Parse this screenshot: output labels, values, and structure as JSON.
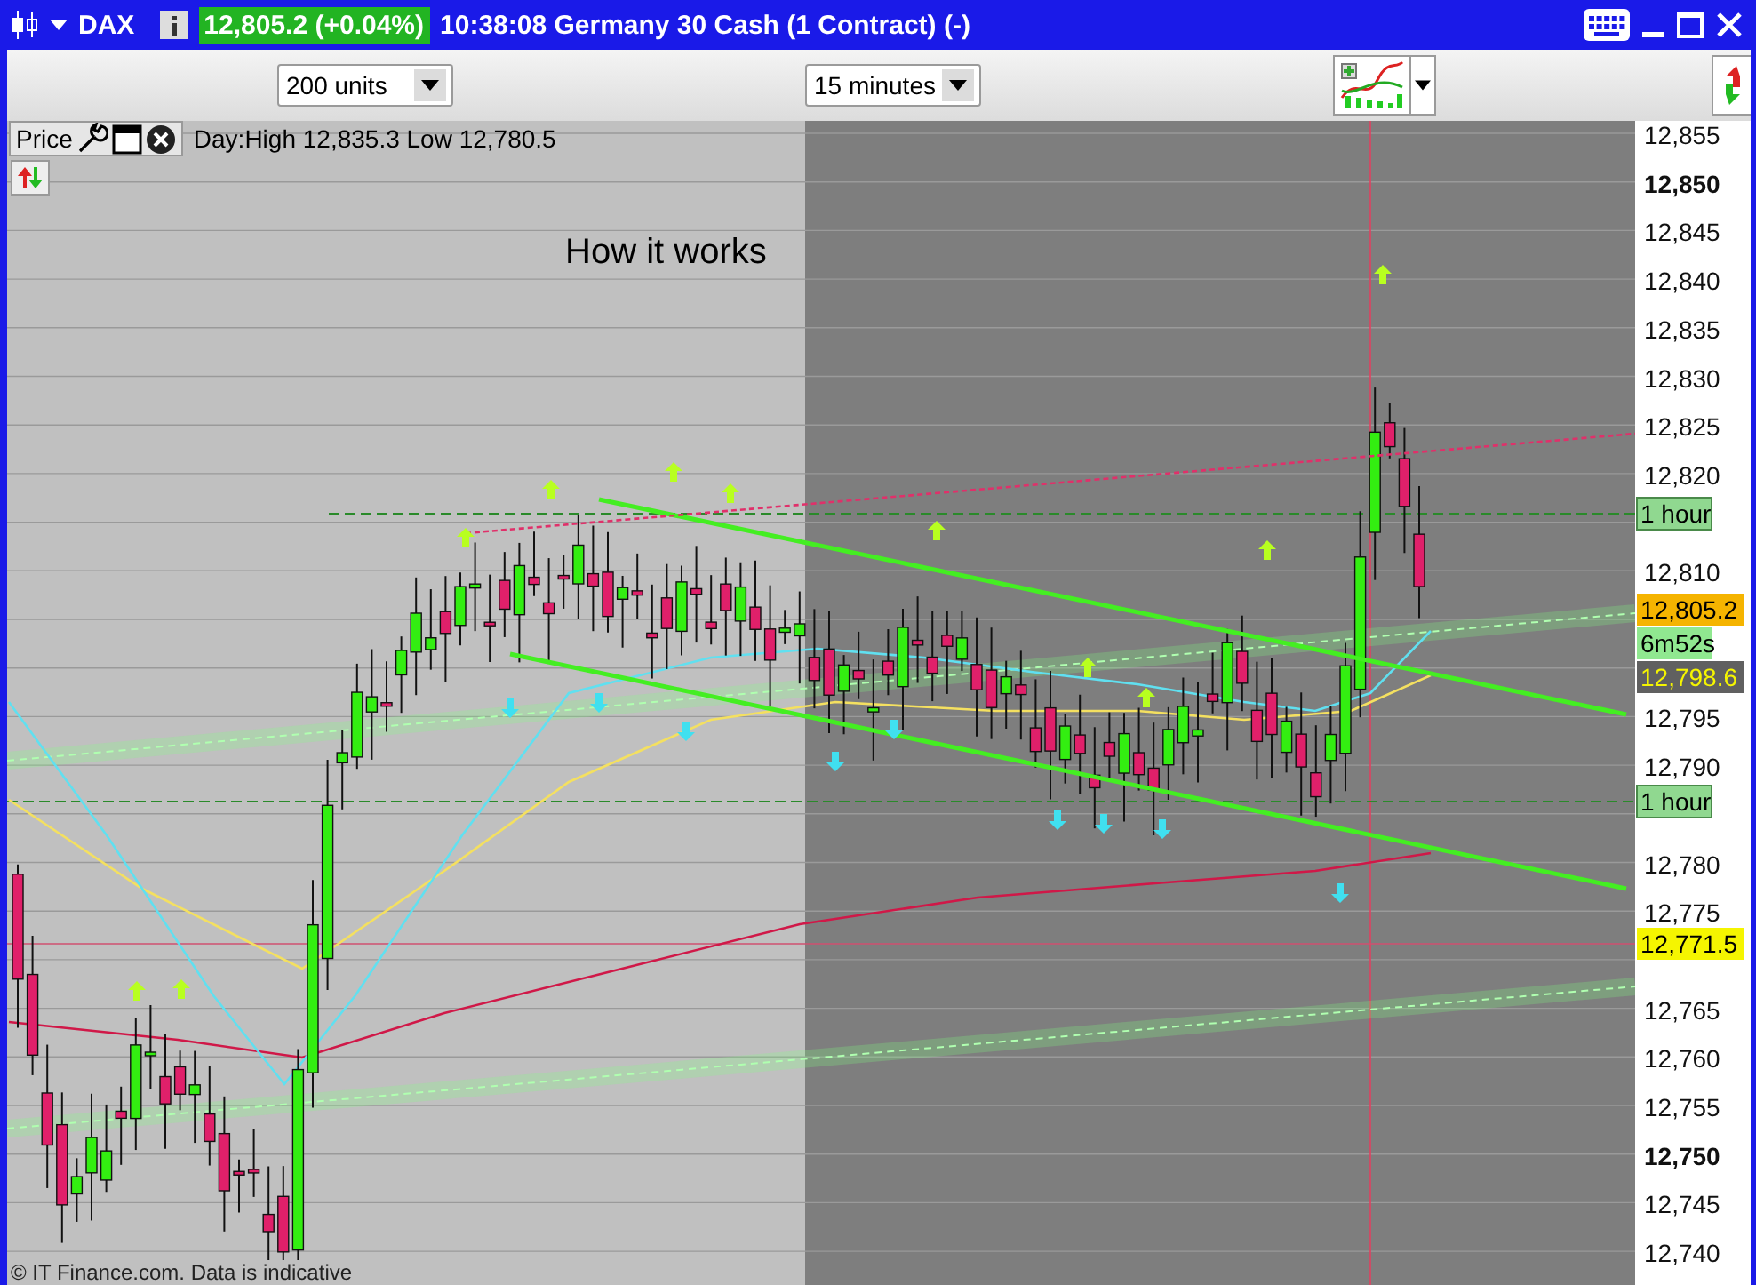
{
  "title_bar": {
    "instrument": "DAX",
    "price": "12,805.2 (+0.04%)",
    "description": "10:38:08 Germany 30 Cash (1 Contract) (-)"
  },
  "toolbar": {
    "units": "200 units",
    "interval": "15 minutes"
  },
  "panel": {
    "label": "Price",
    "day_range": "Day:High 12,835.3 Low 12,780.5"
  },
  "chart": {
    "annotation": "How it works",
    "y_ticks": [
      {
        "label": "12,855",
        "major": false
      },
      {
        "label": "12,850",
        "major": true
      },
      {
        "label": "12,845",
        "major": false
      },
      {
        "label": "12,840",
        "major": false
      },
      {
        "label": "12,835",
        "major": false
      },
      {
        "label": "12,830",
        "major": false
      },
      {
        "label": "12,825",
        "major": false
      },
      {
        "label": "12,820",
        "major": false
      },
      {
        "label": "12,810",
        "major": false
      },
      {
        "label": "12,795",
        "major": false
      },
      {
        "label": "12,790",
        "major": false
      },
      {
        "label": "12,780",
        "major": false
      },
      {
        "label": "12,775",
        "major": false
      },
      {
        "label": "12,765",
        "major": false
      },
      {
        "label": "12,760",
        "major": false
      },
      {
        "label": "12,755",
        "major": false
      },
      {
        "label": "12,750",
        "major": true
      },
      {
        "label": "12,745",
        "major": false
      },
      {
        "label": "12,740",
        "major": false
      }
    ],
    "markers": [
      {
        "kind": "level",
        "label": "1 hour",
        "color": "#90d890"
      },
      {
        "kind": "price",
        "label": "12,805.2",
        "color": "#f5b400"
      },
      {
        "kind": "timer",
        "label": "6m52s",
        "color": "#90e890"
      },
      {
        "kind": "price",
        "label": "12,798.6",
        "color": "#606060"
      },
      {
        "kind": "level",
        "label": "1 hour",
        "color": "#90d890"
      },
      {
        "kind": "price",
        "label": "12,771.5",
        "color": "#f5f500"
      }
    ]
  },
  "footer": "© IT Finance.com. Data is indicative"
}
